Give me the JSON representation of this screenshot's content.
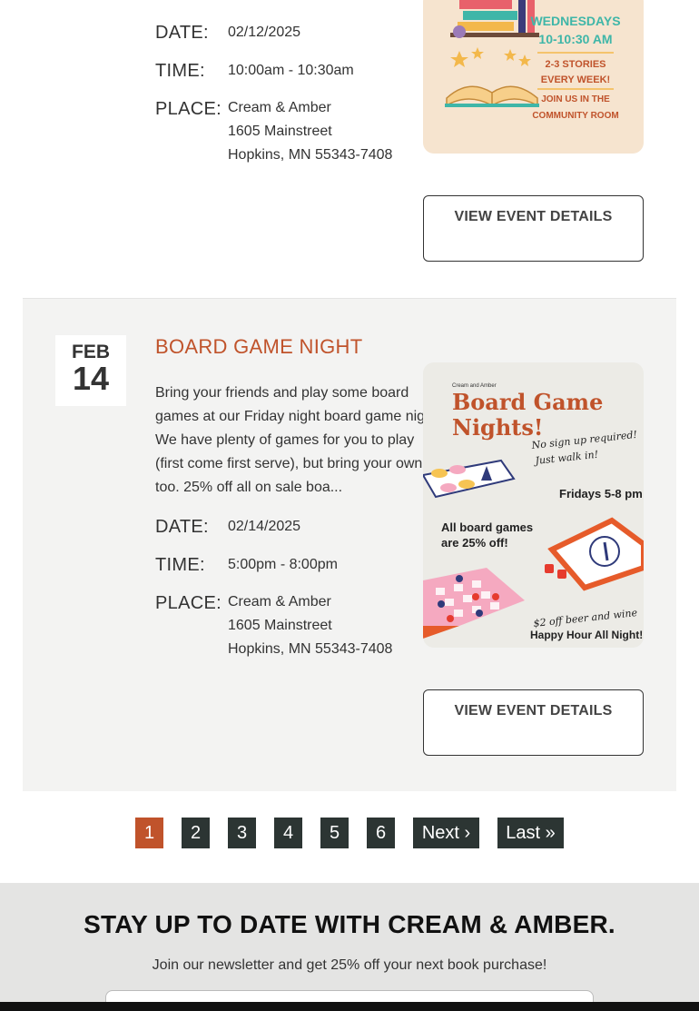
{
  "events": [
    {
      "date_label": "DATE:",
      "date": "02/12/2025",
      "time_label": "TIME:",
      "time": "10:00am - 10:30am",
      "place_label": "PLACE:",
      "place_line1": "Cream & Amber",
      "place_line2": "1605 Mainstreet",
      "place_line3": "Hopkins, MN 55343-7408",
      "button": "VIEW EVENT DETAILS",
      "poster": {
        "line1": "WEDNESDAYS",
        "line2": "10-10:30 AM",
        "line3": "2-3 STORIES",
        "line4": "EVERY WEEK!",
        "line5": "JOIN US IN THE",
        "line6": "COMMUNITY ROOM",
        "bg": "#f6e4cf",
        "accent": "#3fb6a8",
        "text_color": "#c0532b"
      }
    },
    {
      "month": "FEB",
      "day": "14",
      "title": "BOARD GAME NIGHT",
      "description": "Bring your friends and play some board games at our Friday night board game night. We have plenty of games for you to play (first come first serve), but bring your own too. 25% off all on sale boa...",
      "date_label": "DATE:",
      "date": "02/14/2025",
      "time_label": "TIME:",
      "time": "5:00pm - 8:00pm",
      "place_label": "PLACE:",
      "place_line1": "Cream & Amber",
      "place_line2": "1605 Mainstreet",
      "place_line3": "Hopkins, MN 55343-7408",
      "button": "VIEW EVENT DETAILS",
      "poster": {
        "brand": "Cream and Amber",
        "title1": "Board Game",
        "title2": "Nights!",
        "script1": "No sign up required!",
        "script2": "Just walk in!",
        "hours": "Fridays 5-8 pm",
        "sale1": "All board games",
        "sale2": "are 25% off!",
        "script3": "$2 off beer and wine",
        "happy": "Happy Hour All Night!",
        "bg": "#ecebe6",
        "accent": "#c0532b"
      }
    }
  ],
  "pagination": {
    "pages": [
      "1",
      "2",
      "3",
      "4",
      "5",
      "6"
    ],
    "active": "1",
    "next": "Next ›",
    "last": "Last »"
  },
  "newsletter": {
    "title": "STAY UP TO DATE WITH CREAM & AMBER.",
    "subtitle": "Join our newsletter and get 25% off your next book purchase!"
  },
  "colors": {
    "accent": "#c0532b",
    "pager_bg": "#2c3533",
    "event_bg": "#f3f3f2",
    "newsletter_bg": "#e4e4e3"
  }
}
